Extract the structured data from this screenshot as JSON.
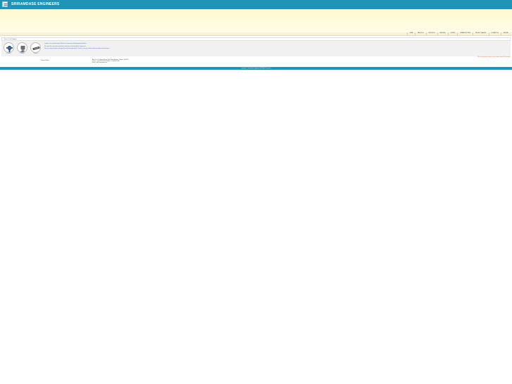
{
  "header": {
    "brand": "SRIRAMDASE ENGINEERS",
    "logo_icon": "company-logo-icon",
    "bg": "#1f93b8"
  },
  "nav": {
    "items": [
      "HOME",
      "ABOUT US",
      "PRODUCTS",
      "SERVICES",
      "CLIENTS",
      "INFRASTRUCTURE",
      "PRODUCT GALLERY",
      "CONTACT US",
      "ENQUIRY"
    ]
  },
  "breadcrumb": {
    "home": "Home",
    "separator": ">>",
    "current": "Our Products"
  },
  "products": [
    {
      "caption": "Product 1"
    },
    {
      "caption": "Product 2"
    },
    {
      "caption": "Product 3"
    }
  ],
  "description": {
    "line1": "Leader in the manufacturing of Machine Components and Engineering Products.",
    "line2": "We specialize in precision machining, fabrication and assembly of components.",
    "line3": "View our range of products designed for industrial applications. Contact us for more details about our products and services."
  },
  "note": "Click on the product images to view a larger version of the product.",
  "contact": {
    "label": "Contact Details :",
    "address": "Add : No. 12, Industrial Estate, Main Road, Ambattur, Chennai - 600 058",
    "phone": "Phone : +91 44 2625 6789 | Mobile : +91 98400 12345",
    "email": "E-mail : info@sriramdase.com"
  },
  "footer": {
    "text": "Copyright © Sriramdase Engineers. All Rights Reserved."
  }
}
